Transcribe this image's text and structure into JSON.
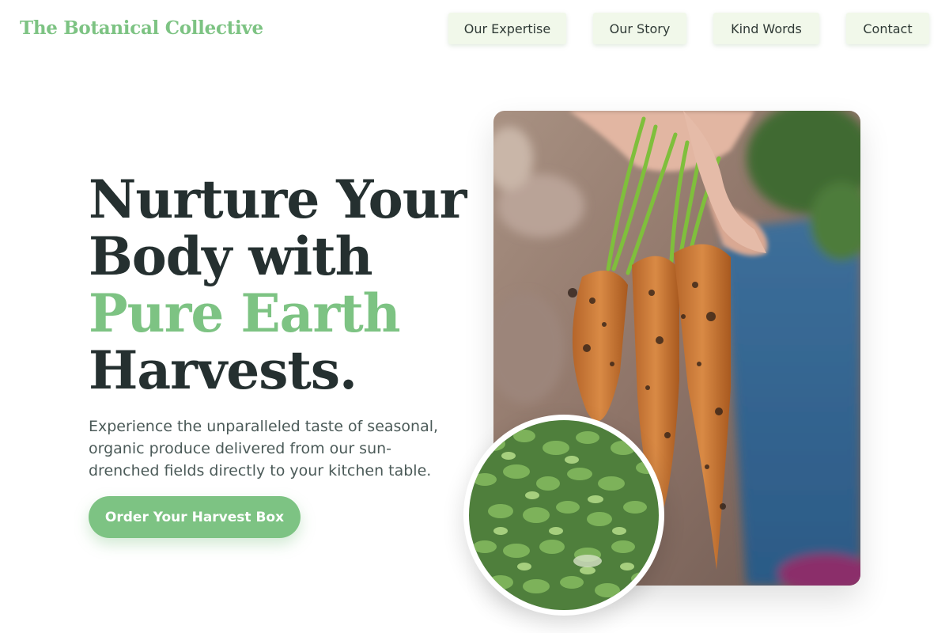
{
  "brand": {
    "name": "The Botanical Collective"
  },
  "nav": {
    "items": [
      {
        "label": "Our Expertise"
      },
      {
        "label": "Our Story"
      },
      {
        "label": "Kind Words"
      },
      {
        "label": "Contact"
      }
    ]
  },
  "hero": {
    "headline_lines": [
      "Nurture Your",
      "Body with",
      "Pure Earth",
      "Harvests."
    ],
    "subtitle": "Experience the unparalleled taste of seasonal, organic produce delivered from our sun-drenched fields directly to your kitchen table.",
    "cta_label": "Order Your Harvest Box"
  },
  "images": {
    "main": "carrots-photo",
    "inset": "microgreens-photo"
  },
  "colors": {
    "accent": "#7dc383",
    "heading": "#253030",
    "nav_bg": "#f1f8ea",
    "body_text": "#4b5a58"
  }
}
